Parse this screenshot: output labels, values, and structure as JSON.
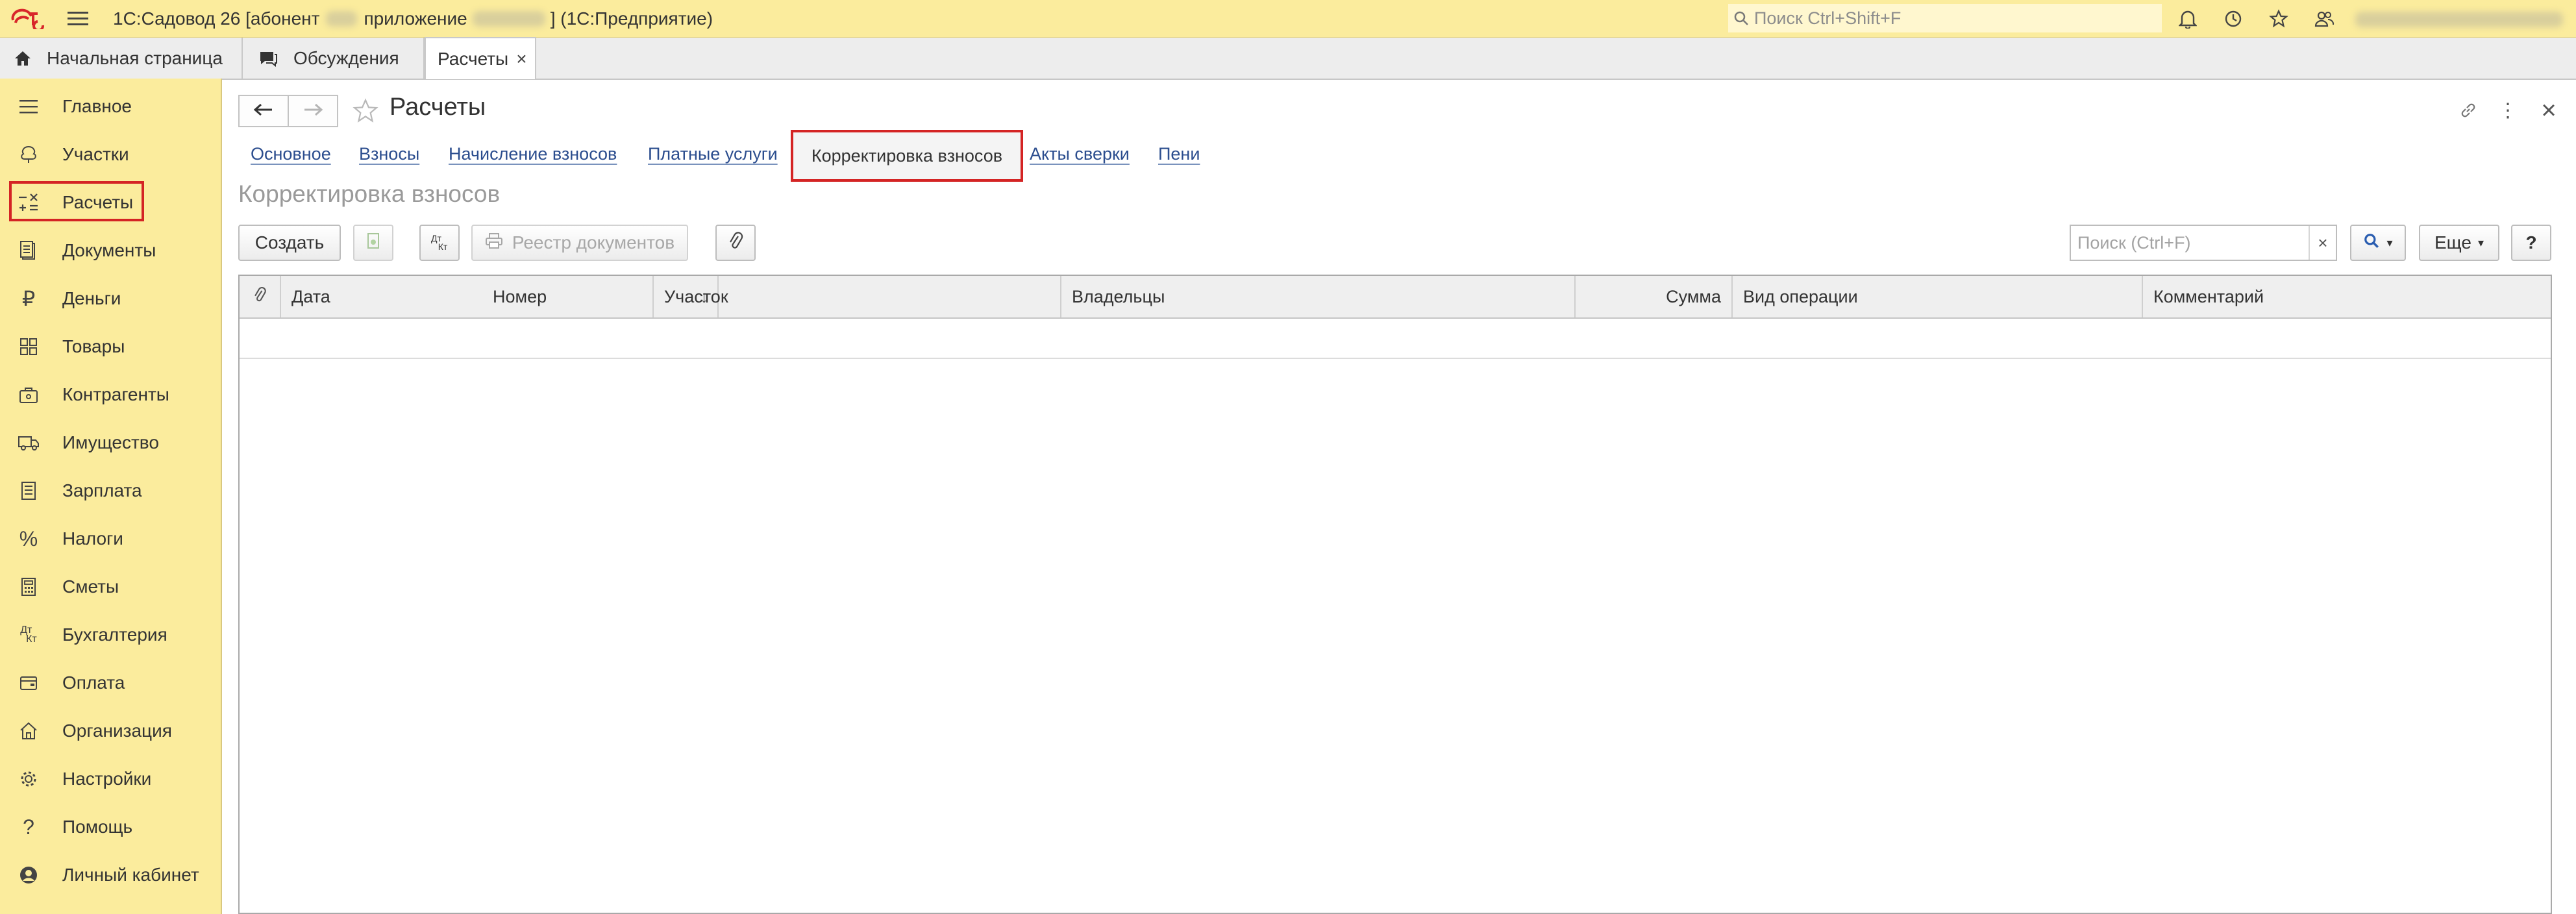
{
  "titlebar": {
    "app_title_prefix": "1С:Садовод 26 [абонент",
    "app_title_mid": "приложение",
    "app_title_suffix": "] (1С:Предприятие)",
    "search_placeholder": "Поиск Ctrl+Shift+F"
  },
  "tabs": [
    {
      "label": "Начальная страница",
      "icon": "home-icon"
    },
    {
      "label": "Обсуждения",
      "icon": "chat-icon"
    },
    {
      "label": "Расчеты",
      "icon": "close-icon"
    }
  ],
  "sidebar": {
    "items": [
      {
        "label": "Главное",
        "icon": "menu-icon"
      },
      {
        "label": "Участки",
        "icon": "plot-icon"
      },
      {
        "label": "Расчеты",
        "icon": "calculations-icon"
      },
      {
        "label": "Документы",
        "icon": "documents-icon"
      },
      {
        "label": "Деньги",
        "icon": "ruble-icon"
      },
      {
        "label": "Товары",
        "icon": "goods-icon"
      },
      {
        "label": "Контрагенты",
        "icon": "counterparties-icon"
      },
      {
        "label": "Имущество",
        "icon": "truck-icon"
      },
      {
        "label": "Зарплата",
        "icon": "salary-icon"
      },
      {
        "label": "Налоги",
        "icon": "percent-icon"
      },
      {
        "label": "Сметы",
        "icon": "calculator-icon"
      },
      {
        "label": "Бухгалтерия",
        "icon": "accounting-icon"
      },
      {
        "label": "Оплата",
        "icon": "payment-icon"
      },
      {
        "label": "Организация",
        "icon": "organization-icon"
      },
      {
        "label": "Настройки",
        "icon": "gear-icon"
      },
      {
        "label": "Помощь",
        "icon": "help-icon"
      },
      {
        "label": "Личный кабинет",
        "icon": "user-icon"
      }
    ]
  },
  "page": {
    "title": "Расчеты",
    "section_title": "Корректировка взносов",
    "links": [
      "Основное",
      "Взносы",
      "Начисление взносов",
      "Платные услуги",
      "Корректировка взносов",
      "Акты сверки",
      "Пени"
    ]
  },
  "toolbar": {
    "create_label": "Создать",
    "dtkt_top": "Дт",
    "dtkt_bottom": "Кт",
    "registry_label": "Реестр документов",
    "search_placeholder": "Поиск (Ctrl+F)",
    "clear_label": "×",
    "more_label": "Еще",
    "help_label": "?"
  },
  "table": {
    "columns": [
      "Дата",
      "Номер",
      "Участок",
      "Владельцы",
      "Сумма",
      "Вид операции",
      "Комментарий"
    ]
  }
}
